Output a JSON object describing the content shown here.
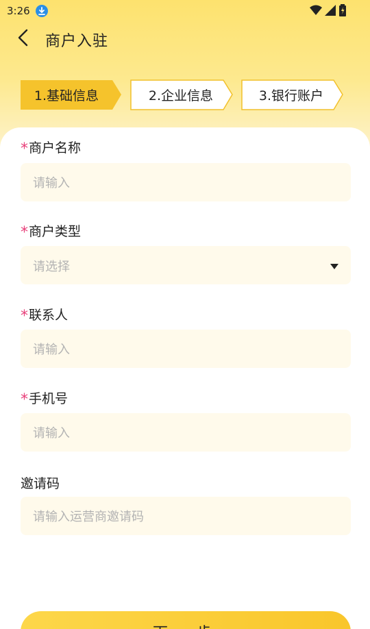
{
  "status_bar": {
    "time": "3:26"
  },
  "header": {
    "title": "商户入驻"
  },
  "steps": [
    {
      "label": "1.基础信息",
      "active": true
    },
    {
      "label": "2.企业信息",
      "active": false
    },
    {
      "label": "3.银行账户",
      "active": false
    }
  ],
  "form": {
    "required_mark": "*",
    "merchant_name": {
      "label": "商户名称",
      "placeholder": "请输入",
      "value": ""
    },
    "merchant_type": {
      "label": "商户类型",
      "placeholder": "请选择",
      "value": ""
    },
    "contact": {
      "label": "联系人",
      "placeholder": "请输入",
      "value": ""
    },
    "phone": {
      "label": "手机号",
      "placeholder": "请输入",
      "value": ""
    },
    "invite_code": {
      "label": "邀请码",
      "placeholder": "请输入运营商邀请码",
      "value": ""
    }
  },
  "footer": {
    "next_label": "下一步"
  },
  "colors": {
    "accent": "#f9c62b",
    "required": "#e8407a",
    "field_bg": "#fffaeb",
    "placeholder": "#b3b3b3"
  }
}
